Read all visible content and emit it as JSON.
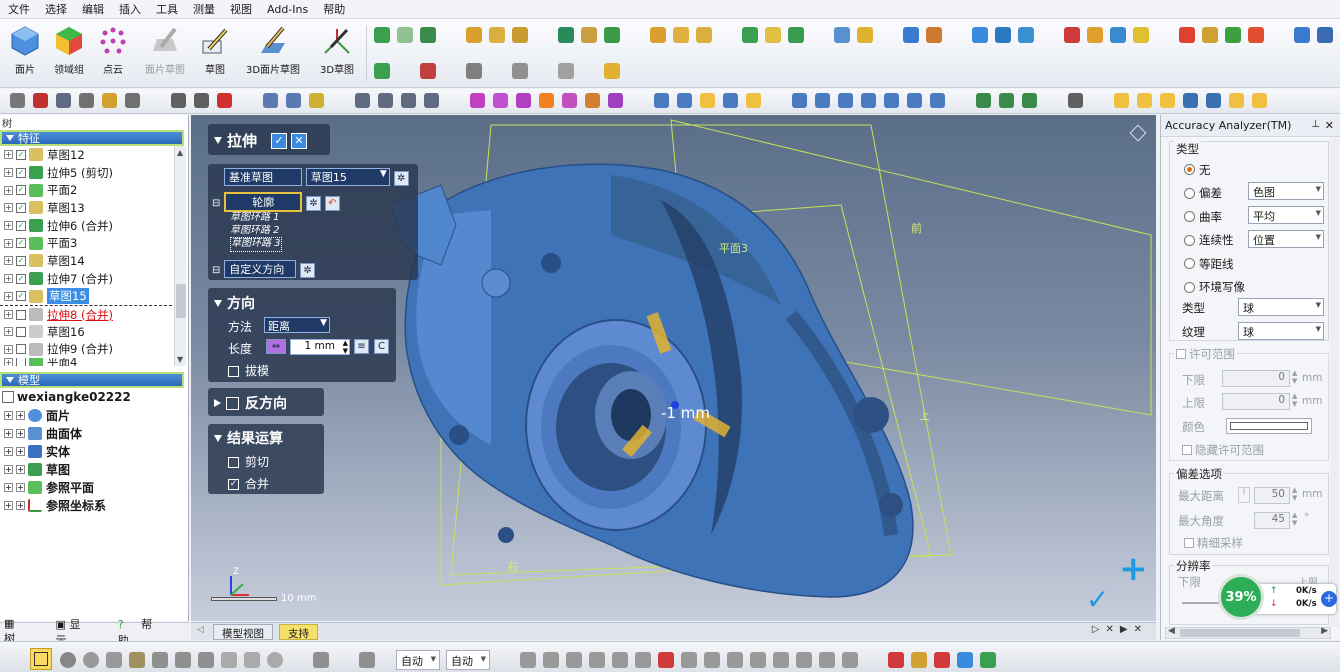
{
  "menu": [
    "文件",
    "选择",
    "编辑",
    "插入",
    "工具",
    "测量",
    "视图",
    "Add-Ins",
    "帮助"
  ],
  "ribbon": {
    "tools": [
      "面片",
      "领域组",
      "点云",
      "面片草图",
      "草图",
      "3D面片草图",
      "3D草图"
    ]
  },
  "tree": {
    "header": "树",
    "features_label": "特征",
    "features": [
      "草图12",
      "拉伸5 (剪切)",
      "平面2",
      "草图13",
      "拉伸6 (合并)",
      "平面3",
      "草图14",
      "拉伸7 (合并)",
      "草图15",
      "拉伸8 (合并)",
      "草图16",
      "拉伸9 (合并)",
      "平面4"
    ],
    "model_label": "模型",
    "model_root": "wexiangke02222",
    "model_items": [
      "面片",
      "曲面体",
      "实体",
      "草图",
      "参照平面",
      "参照坐标系"
    ]
  },
  "left_tabs": [
    "树",
    "显示",
    "帮助"
  ],
  "feature_panel": {
    "title": "拉伸",
    "base_sketch_label": "基准草图",
    "base_sketch_value": "草图15",
    "profile_label": "轮廓",
    "loops": [
      "草图环路 1",
      "草图环路 2",
      "草图环路 3"
    ],
    "custom_dir_label": "自定义方向",
    "direction_title": "方向",
    "method_label": "方法",
    "method_value": "距离",
    "length_label": "长度",
    "length_value": "1 mm",
    "draft_label": "拔模",
    "reverse_label": "反方向",
    "result_title": "结果运算",
    "cut_label": "剪切",
    "merge_label": "合并"
  },
  "viewport": {
    "measure_label": "-1 mm",
    "plane_labels": [
      "前",
      "平面3",
      "上",
      "右"
    ],
    "axis_z": "Z",
    "scale_label": "10 mm",
    "tabs": [
      "模型视图",
      "支持"
    ]
  },
  "accuracy": {
    "title": "Accuracy Analyzer(TM)",
    "type_group": "类型",
    "options": [
      "无",
      "偏差",
      "曲率",
      "连续性",
      "等距线",
      "环境写像"
    ],
    "selected_index": 0,
    "deviation_value": "色图",
    "curvature_value": "平均",
    "continuity_value": "位置",
    "sub_type_label": "类型",
    "sub_type_value": "球",
    "texture_label": "纹理",
    "texture_value": "球",
    "tolerance_group": "许可范围",
    "lower_label": "下限",
    "lower_value": "0",
    "upper_label": "上限",
    "upper_value": "0",
    "unit_mm": "mm",
    "color_label": "颜色",
    "hide_tol_label": "隐藏许可范围",
    "dev_options_group": "偏差选项",
    "max_dist_label": "最大距离",
    "max_dist_value": "50",
    "max_angle_label": "最大角度",
    "max_angle_value": "45",
    "degree_unit": "°",
    "fine_sample_label": "精细采样",
    "resolution_group": "分辨率",
    "res_lower": "下限",
    "res_upper": "上限"
  },
  "net_widget": {
    "percent": "39%",
    "up": "0K/s",
    "down": "0K/s"
  },
  "statusbar": {
    "combo1": "自动",
    "combo2": "自动"
  },
  "colors": {
    "accent": "#3b8ee6",
    "mesh": "#4a86c8",
    "plane": "#c8e05a",
    "select_border": "#b7e07a"
  }
}
